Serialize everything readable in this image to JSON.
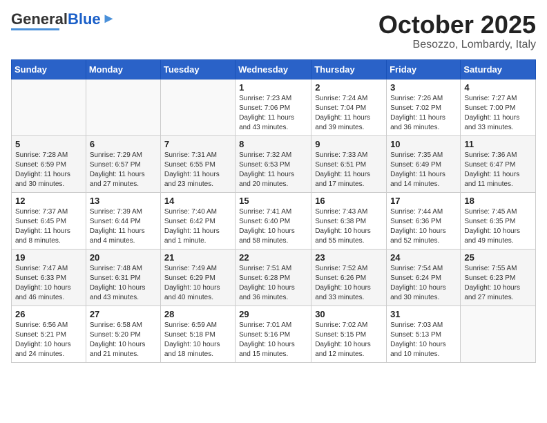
{
  "header": {
    "logo_general": "General",
    "logo_blue": "Blue",
    "month_title": "October 2025",
    "location": "Besozzo, Lombardy, Italy"
  },
  "weekdays": [
    "Sunday",
    "Monday",
    "Tuesday",
    "Wednesday",
    "Thursday",
    "Friday",
    "Saturday"
  ],
  "weeks": [
    [
      {
        "day": "",
        "info": ""
      },
      {
        "day": "",
        "info": ""
      },
      {
        "day": "",
        "info": ""
      },
      {
        "day": "1",
        "info": "Sunrise: 7:23 AM\nSunset: 7:06 PM\nDaylight: 11 hours\nand 43 minutes."
      },
      {
        "day": "2",
        "info": "Sunrise: 7:24 AM\nSunset: 7:04 PM\nDaylight: 11 hours\nand 39 minutes."
      },
      {
        "day": "3",
        "info": "Sunrise: 7:26 AM\nSunset: 7:02 PM\nDaylight: 11 hours\nand 36 minutes."
      },
      {
        "day": "4",
        "info": "Sunrise: 7:27 AM\nSunset: 7:00 PM\nDaylight: 11 hours\nand 33 minutes."
      }
    ],
    [
      {
        "day": "5",
        "info": "Sunrise: 7:28 AM\nSunset: 6:59 PM\nDaylight: 11 hours\nand 30 minutes."
      },
      {
        "day": "6",
        "info": "Sunrise: 7:29 AM\nSunset: 6:57 PM\nDaylight: 11 hours\nand 27 minutes."
      },
      {
        "day": "7",
        "info": "Sunrise: 7:31 AM\nSunset: 6:55 PM\nDaylight: 11 hours\nand 23 minutes."
      },
      {
        "day": "8",
        "info": "Sunrise: 7:32 AM\nSunset: 6:53 PM\nDaylight: 11 hours\nand 20 minutes."
      },
      {
        "day": "9",
        "info": "Sunrise: 7:33 AM\nSunset: 6:51 PM\nDaylight: 11 hours\nand 17 minutes."
      },
      {
        "day": "10",
        "info": "Sunrise: 7:35 AM\nSunset: 6:49 PM\nDaylight: 11 hours\nand 14 minutes."
      },
      {
        "day": "11",
        "info": "Sunrise: 7:36 AM\nSunset: 6:47 PM\nDaylight: 11 hours\nand 11 minutes."
      }
    ],
    [
      {
        "day": "12",
        "info": "Sunrise: 7:37 AM\nSunset: 6:45 PM\nDaylight: 11 hours\nand 8 minutes."
      },
      {
        "day": "13",
        "info": "Sunrise: 7:39 AM\nSunset: 6:44 PM\nDaylight: 11 hours\nand 4 minutes."
      },
      {
        "day": "14",
        "info": "Sunrise: 7:40 AM\nSunset: 6:42 PM\nDaylight: 11 hours\nand 1 minute."
      },
      {
        "day": "15",
        "info": "Sunrise: 7:41 AM\nSunset: 6:40 PM\nDaylight: 10 hours\nand 58 minutes."
      },
      {
        "day": "16",
        "info": "Sunrise: 7:43 AM\nSunset: 6:38 PM\nDaylight: 10 hours\nand 55 minutes."
      },
      {
        "day": "17",
        "info": "Sunrise: 7:44 AM\nSunset: 6:36 PM\nDaylight: 10 hours\nand 52 minutes."
      },
      {
        "day": "18",
        "info": "Sunrise: 7:45 AM\nSunset: 6:35 PM\nDaylight: 10 hours\nand 49 minutes."
      }
    ],
    [
      {
        "day": "19",
        "info": "Sunrise: 7:47 AM\nSunset: 6:33 PM\nDaylight: 10 hours\nand 46 minutes."
      },
      {
        "day": "20",
        "info": "Sunrise: 7:48 AM\nSunset: 6:31 PM\nDaylight: 10 hours\nand 43 minutes."
      },
      {
        "day": "21",
        "info": "Sunrise: 7:49 AM\nSunset: 6:29 PM\nDaylight: 10 hours\nand 40 minutes."
      },
      {
        "day": "22",
        "info": "Sunrise: 7:51 AM\nSunset: 6:28 PM\nDaylight: 10 hours\nand 36 minutes."
      },
      {
        "day": "23",
        "info": "Sunrise: 7:52 AM\nSunset: 6:26 PM\nDaylight: 10 hours\nand 33 minutes."
      },
      {
        "day": "24",
        "info": "Sunrise: 7:54 AM\nSunset: 6:24 PM\nDaylight: 10 hours\nand 30 minutes."
      },
      {
        "day": "25",
        "info": "Sunrise: 7:55 AM\nSunset: 6:23 PM\nDaylight: 10 hours\nand 27 minutes."
      }
    ],
    [
      {
        "day": "26",
        "info": "Sunrise: 6:56 AM\nSunset: 5:21 PM\nDaylight: 10 hours\nand 24 minutes."
      },
      {
        "day": "27",
        "info": "Sunrise: 6:58 AM\nSunset: 5:20 PM\nDaylight: 10 hours\nand 21 minutes."
      },
      {
        "day": "28",
        "info": "Sunrise: 6:59 AM\nSunset: 5:18 PM\nDaylight: 10 hours\nand 18 minutes."
      },
      {
        "day": "29",
        "info": "Sunrise: 7:01 AM\nSunset: 5:16 PM\nDaylight: 10 hours\nand 15 minutes."
      },
      {
        "day": "30",
        "info": "Sunrise: 7:02 AM\nSunset: 5:15 PM\nDaylight: 10 hours\nand 12 minutes."
      },
      {
        "day": "31",
        "info": "Sunrise: 7:03 AM\nSunset: 5:13 PM\nDaylight: 10 hours\nand 10 minutes."
      },
      {
        "day": "",
        "info": ""
      }
    ]
  ]
}
